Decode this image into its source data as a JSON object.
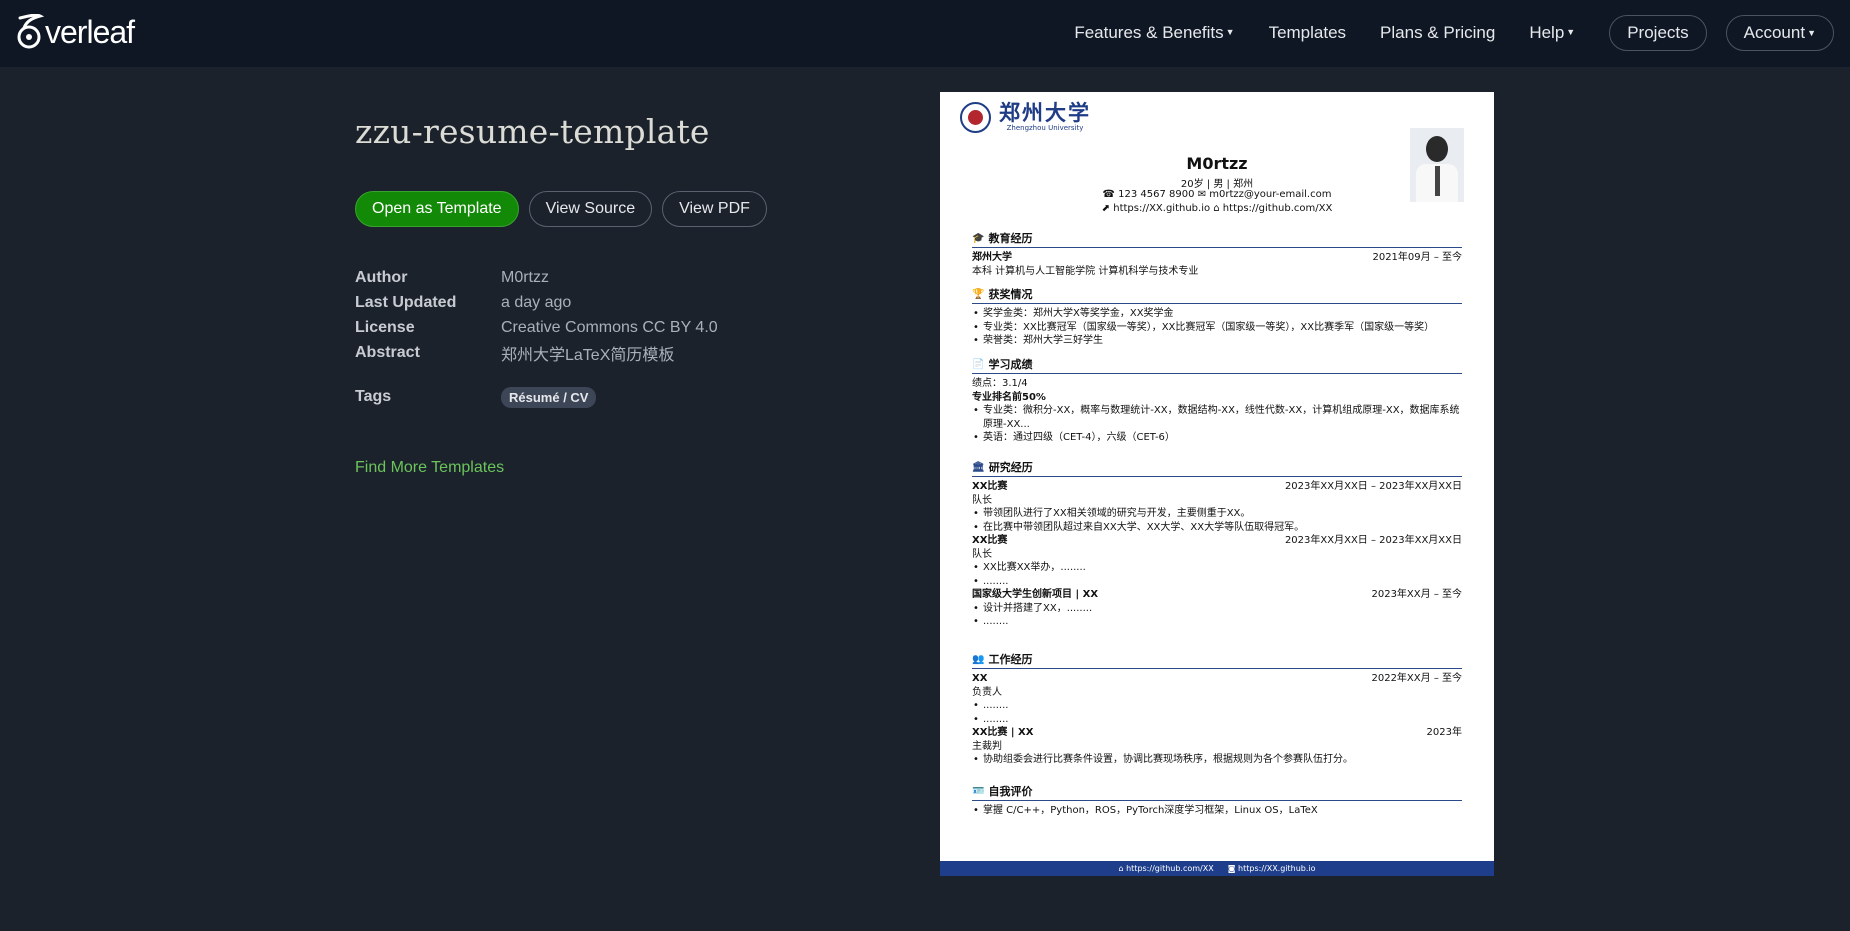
{
  "brand": {
    "name": "Overleaf",
    "logo_word": "verleaf"
  },
  "nav": {
    "features": "Features & Benefits",
    "templates": "Templates",
    "plans": "Plans & Pricing",
    "help": "Help",
    "projects": "Projects",
    "account": "Account"
  },
  "template": {
    "title": "zzu-resume-template",
    "buttons": {
      "open": "Open as Template",
      "source": "View Source",
      "pdf": "View PDF"
    },
    "meta": [
      {
        "key": "Author",
        "value": "M0rtzz"
      },
      {
        "key": "Last Updated",
        "value": "a day ago"
      },
      {
        "key": "License",
        "value": "Creative Commons CC BY 4.0"
      },
      {
        "key": "Abstract",
        "value": "郑州大学LaTeX简历模板"
      }
    ],
    "tags_label": "Tags",
    "tags": [
      "Résumé / CV"
    ],
    "find_more": "Find More Templates"
  },
  "preview": {
    "university_cn": "郑州大学",
    "university_en": "Zhengzhou University",
    "name": "M0rtzz",
    "info": "20岁 | 男 | 郑州",
    "contact": "☎ 123 4567 8900    ✉ m0rtzz@your-email.com",
    "links": "⬈ https://XX.github.io    ⌂ https://github.com/XX",
    "edu": {
      "title": "教育经历",
      "school": "郑州大学",
      "date": "2021年09月 – 至今",
      "detail": "本科   计算机与人工智能学院   计算机科学与技术专业"
    },
    "awards": {
      "title": "获奖情况",
      "items": [
        "奖学金类：郑州大学X等奖学金，XX奖学金",
        "专业类：XX比赛冠军（国家级一等奖），XX比赛冠军（国家级一等奖），XX比赛季军（国家级一等奖）",
        "荣誉类：郑州大学三好学生"
      ]
    },
    "grades": {
      "title": "学习成绩",
      "gpa": "绩点：3.1/4",
      "rank": "专业排名前50%",
      "items": [
        "专业类：微积分-XX，概率与数理统计-XX，数据结构-XX，线性代数-XX，计算机组成原理-XX，数据库系统原理-XX...",
        "英语：通过四级（CET-4），六级（CET-6）"
      ]
    },
    "research": {
      "title": "研究经历",
      "entries": [
        {
          "name": "XX比赛",
          "date": "2023年XX月XX日 – 2023年XX月XX日",
          "role": "队长",
          "items": [
            "带领团队进行了XX相关领域的研究与开发，主要侧重于XX。",
            "在比赛中带领团队超过来自XX大学、XX大学、XX大学等队伍取得冠军。"
          ]
        },
        {
          "name": "XX比赛",
          "date": "2023年XX月XX日 – 2023年XX月XX日",
          "role": "队长",
          "items": [
            "XX比赛XX举办，........",
            "........"
          ]
        },
        {
          "name": "国家级大学生创新项目 | XX",
          "date": "2023年XX月 – 至今",
          "role": "",
          "items": [
            "设计并搭建了XX，........",
            "........"
          ]
        }
      ]
    },
    "work": {
      "title": "工作经历",
      "entries": [
        {
          "name": "XX",
          "date": "2022年XX月 – 至今",
          "role": "负责人",
          "items": [
            "........",
            "........"
          ]
        },
        {
          "name": "XX比赛 | XX",
          "date": "2023年",
          "role": "主裁判",
          "items": [
            "协助组委会进行比赛条件设置，协调比赛现场秩序，根据规则为各个参赛队伍打分。"
          ]
        }
      ]
    },
    "self": {
      "title": "自我评价",
      "items": [
        "掌握 C/C++，Python，ROS，PyTorch深度学习框架，Linux OS，LaTeX"
      ]
    },
    "footer": {
      "github": "https://github.com/XX",
      "blog": "https://XX.github.io"
    }
  }
}
